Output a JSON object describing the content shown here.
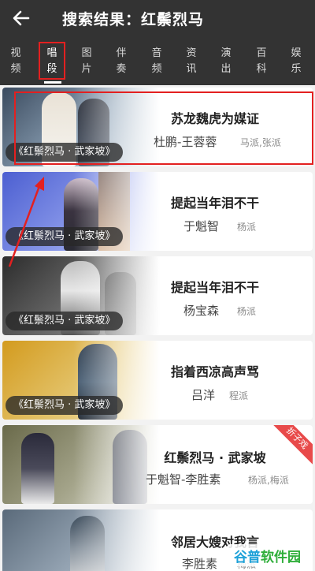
{
  "header": {
    "back_icon": "back-arrow-icon",
    "title": "搜索结果：红鬃烈马"
  },
  "tabs": [
    {
      "label": "视频"
    },
    {
      "label": "唱段",
      "active": true
    },
    {
      "label": "图片"
    },
    {
      "label": "伴奏"
    },
    {
      "label": "音频"
    },
    {
      "label": "资讯"
    },
    {
      "label": "演出"
    },
    {
      "label": "百科"
    },
    {
      "label": "娱乐"
    }
  ],
  "results": [
    {
      "caption": "《红鬃烈马 · 武家坡》",
      "song": "苏龙魏虎为媒证",
      "performer": "杜鹏-王蓉蓉",
      "school": "马派,张派"
    },
    {
      "caption": "《红鬃烈马 · 武家坡》",
      "song": "提起当年泪不干",
      "performer": "于魁智",
      "school": "杨派"
    },
    {
      "caption": "《红鬃烈马 · 武家坡》",
      "song": "提起当年泪不干",
      "performer": "杨宝森",
      "school": "杨派"
    },
    {
      "caption": "《红鬃烈马 · 武家坡》",
      "song": "指着西凉高声骂",
      "performer": "吕洋",
      "school": "程派"
    },
    {
      "caption": "",
      "song": "红鬃烈马 · 武家坡",
      "performer": "于魁智-李胜素",
      "school": "杨派,梅派",
      "badge": "折子戏"
    },
    {
      "caption": "",
      "song": "邻居大嫂对我言",
      "performer": "李胜素",
      "school": "梅派"
    }
  ],
  "watermark": {
    "part1": "谷普",
    "part2": "软件园"
  },
  "colors": {
    "header_bg": "#333333",
    "highlight": "#e32020",
    "badge": "#e84a4a"
  }
}
